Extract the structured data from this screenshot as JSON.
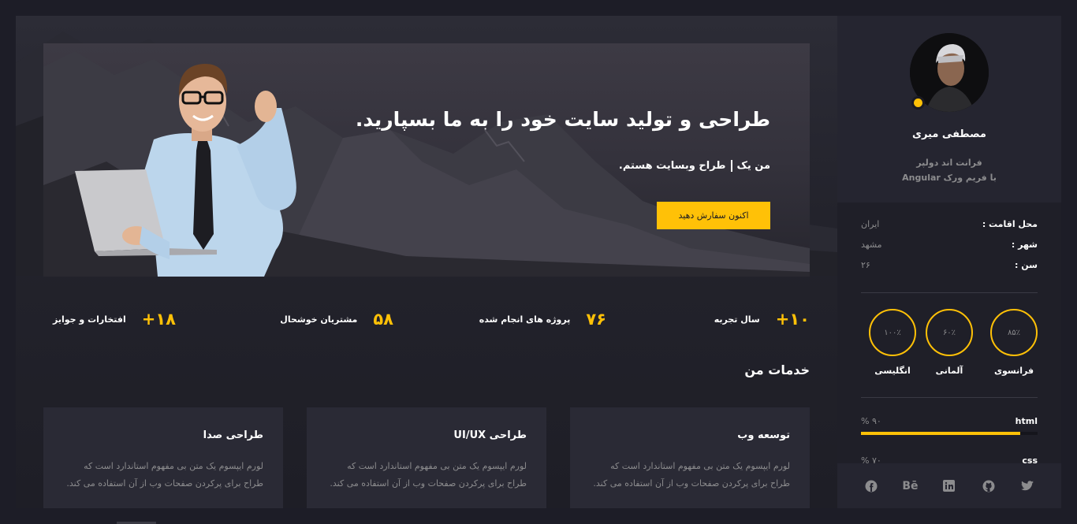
{
  "hero": {
    "title": "طراحی و تولید سایت خود را به ما بسپارید.",
    "subtitle_a": "من یک",
    "subtitle_b": "طراح وبسایت هستم.",
    "cta": "اکنون سفارش دهید"
  },
  "stats": [
    {
      "num": "۱۰+",
      "label": "سال تجربه"
    },
    {
      "num": "۷۶",
      "label": "پروژه های انجام شده"
    },
    {
      "num": "۵۸",
      "label": "مشتریان خوشحال"
    },
    {
      "num": "۱۸+",
      "label": "افتخارات و جوایز"
    }
  ],
  "services": {
    "title": "خدمات من",
    "cards": [
      {
        "title": "توسعه وب",
        "text": "لورم ایپسوم یک متن بی مفهوم استاندارد است که طراح برای پرکردن صفحات وب از آن استفاده می کند."
      },
      {
        "title": "طراحی UI/UX",
        "text": "لورم ایپسوم یک متن بی مفهوم استاندارد است که طراح برای پرکردن صفحات وب از آن استفاده می کند."
      },
      {
        "title": "طراحی صدا",
        "text": "لورم ایپسوم یک متن بی مفهوم استاندارد است که طراح برای پرکردن صفحات وب از آن استفاده می کند."
      }
    ]
  },
  "profile": {
    "name": "مصطفی میری",
    "role_line1": "فرانت اند دولپر",
    "role_line2": "با فریم ورک Angular",
    "status_color": "#ffc107"
  },
  "info": [
    {
      "key": "محل اقامت :",
      "value": "ایران"
    },
    {
      "key": "شهر :",
      "value": "مشهد"
    },
    {
      "key": "سن :",
      "value": "۲۶"
    }
  ],
  "languages": [
    {
      "name": "فرانسوی",
      "percent": "۸۵٪",
      "level": 85
    },
    {
      "name": "آلمانی",
      "percent": "۶۰٪",
      "level": 60
    },
    {
      "name": "انگلیسی",
      "percent": "۱۰۰٪",
      "level": 100
    }
  ],
  "skills": [
    {
      "name": "html",
      "percent": "% ۹۰",
      "level": 0.9
    },
    {
      "name": "css",
      "percent": "% ۷۰",
      "level": 0.7
    }
  ],
  "social_icons": [
    "twitter-icon",
    "github-icon",
    "linkedin-icon",
    "behance-icon",
    "facebook-icon"
  ],
  "colors": {
    "accent": "#ffc107",
    "background": "#1d1d27",
    "card": "#2a2a35"
  }
}
